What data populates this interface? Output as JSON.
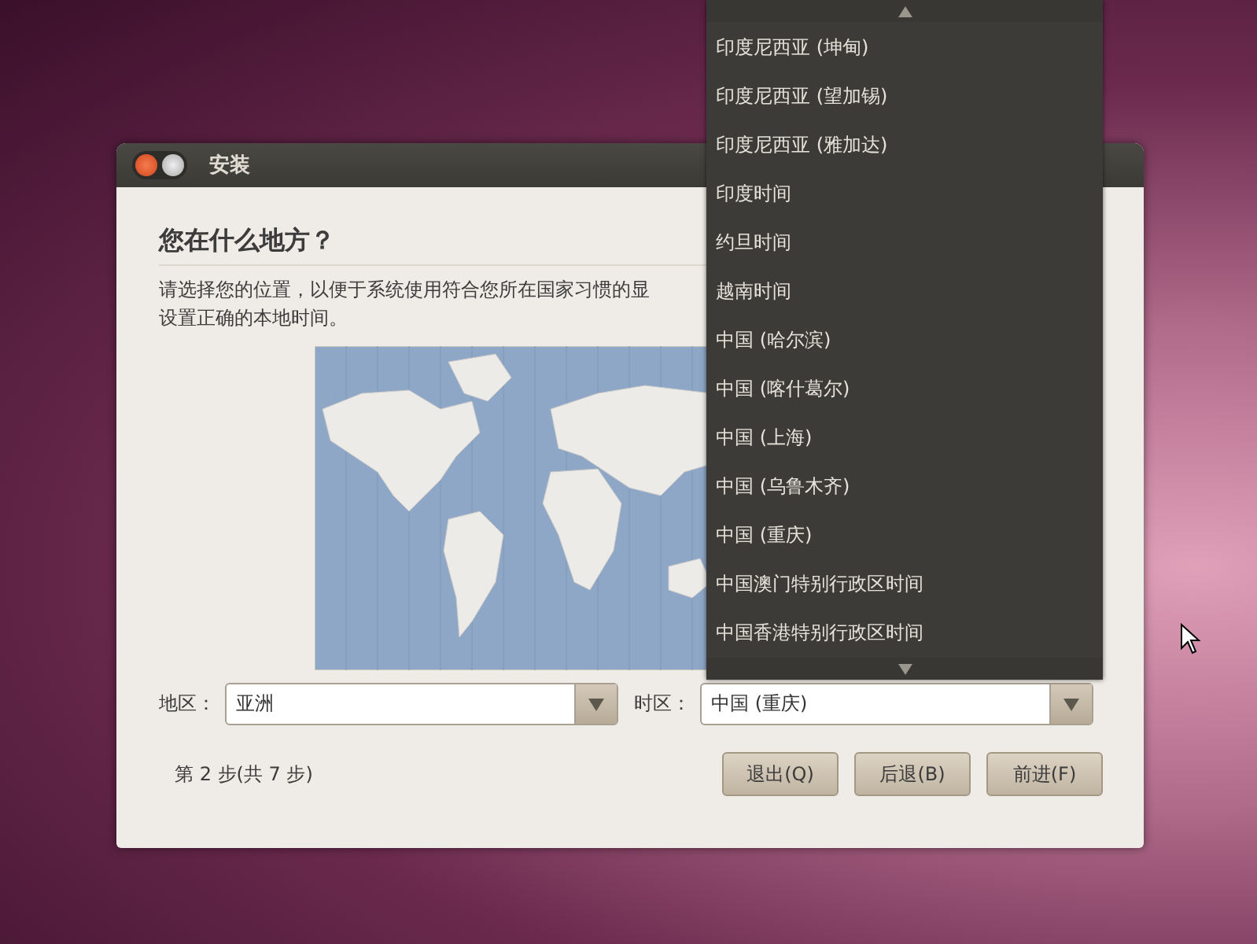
{
  "window": {
    "title": "安装"
  },
  "heading": "您在什么地方？",
  "description": [
    "请选择您的位置，以便于系统使用符合您所在国家习惯的显",
    "设置正确的本地时间。"
  ],
  "region": {
    "label": "地区：",
    "value": "亚洲"
  },
  "timezone": {
    "label": "时区：",
    "value": "中国 (重庆)"
  },
  "timezone_menu": [
    "印度尼西亚 (坤甸)",
    "印度尼西亚 (望加锡)",
    "印度尼西亚 (雅加达)",
    "印度时间",
    "约旦时间",
    "越南时间",
    "中国 (哈尔滨)",
    "中国 (喀什葛尔)",
    "中国 (上海)",
    "中国 (乌鲁木齐)",
    "中国 (重庆)",
    "中国澳门特别行政区时间",
    "中国香港特别行政区时间"
  ],
  "step": "第 2 步(共 7 步)",
  "buttons": [
    "退出(Q)",
    "后退(B)",
    "前进(F)"
  ]
}
